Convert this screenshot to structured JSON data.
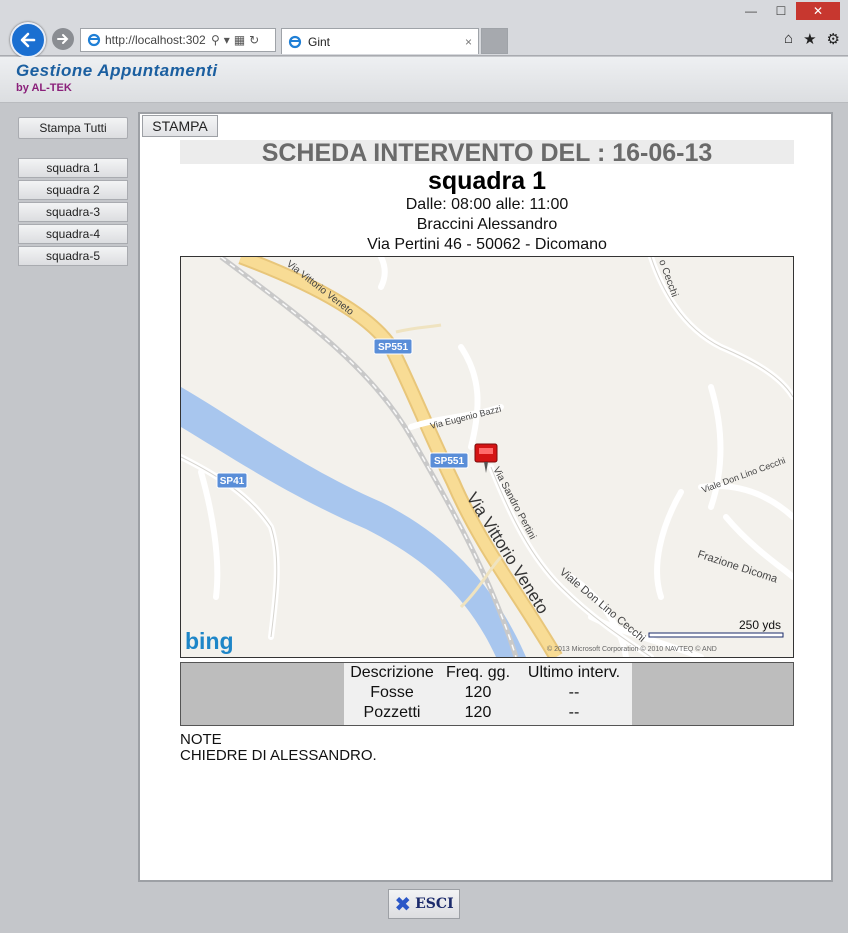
{
  "browser": {
    "url": "http://localhost:302",
    "tab_title": "Gint",
    "tab_close": "×",
    "window_controls": {
      "minimize": "—",
      "maximize": "☐",
      "close": "✕"
    },
    "icons": {
      "home": "⌂",
      "favorites": "★",
      "settings": "⚙"
    }
  },
  "app": {
    "title": "Gestione Appuntamenti",
    "subtitle": "by AL-TEK"
  },
  "sidebar": {
    "print_all_label": "Stampa Tutti",
    "items": [
      {
        "label": "squadra 1"
      },
      {
        "label": "squadra 2"
      },
      {
        "label": "squadra-3"
      },
      {
        "label": "squadra-4"
      },
      {
        "label": "squadra-5"
      }
    ]
  },
  "main": {
    "print_label": "STAMPA",
    "heading": "SCHEDA INTERVENTO DEL : 16-06-13",
    "team": "squadra 1",
    "time_range": "Dalle: 08:00 alle: 11:00",
    "customer": "Braccini Alessandro",
    "address": "Via Pertini 46 - 50062 - Dicomano"
  },
  "map": {
    "labels": {
      "road_vittorio_veneto_top": "Via Vittorio Veneto",
      "road_vittorio_veneto_main": "Via Vittorio Veneto",
      "sp551_a": "SP551",
      "sp551_b": "SP551",
      "sp41": "SP41",
      "eugenio_bazzi": "Via Eugenio Bazzi",
      "sandro_pertini": "Via Sandro Pertini",
      "don_lino_cecchi_a": "Viale Don Lino Cecchi",
      "don_lino_cecchi_b": "Viale Don Lino Cecchi",
      "cecchi_top": "o Cecchi",
      "frazione": "Frazione Dicoma",
      "scale": "250 yds",
      "copyright": "© 2013 Microsoft Corporation    © 2010 NAVTEQ    © AND",
      "brand": "bing"
    }
  },
  "table": {
    "headers": [
      "Descrizione",
      "Freq. gg.",
      "Ultimo interv."
    ],
    "rows": [
      [
        "Fosse",
        "120",
        "--"
      ],
      [
        "Pozzetti",
        "120",
        "--"
      ]
    ]
  },
  "note": {
    "title": "NOTE",
    "text": "CHIEDRE DI ALESSANDRO."
  },
  "footer": {
    "exit_label": "ESCI"
  },
  "colors": {
    "accent_blue": "#1a6fd1",
    "title_blue": "#1b5fa0",
    "subtitle_purple": "#8a1f7a",
    "pin_red": "#d41414"
  }
}
